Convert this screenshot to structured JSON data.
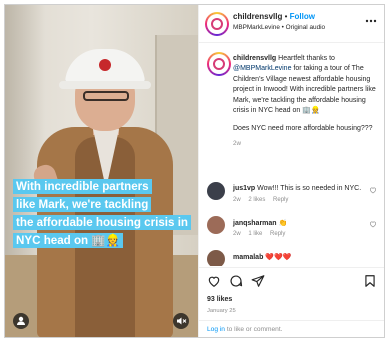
{
  "video": {
    "caption_lines": [
      "With incredible partners",
      "like Mark, we're tackling",
      "the affordable housing crisis in",
      "NYC head on 🏢👷"
    ],
    "user_tag_icon": "person-icon",
    "audio_icon": "speaker-muted-icon"
  },
  "header": {
    "username": "childrensvllg",
    "separator": "•",
    "follow_label": "Follow",
    "subline": "MBPMarkLevine • Original audio",
    "more_icon": "more-horizontal-icon"
  },
  "post": {
    "username": "childrensvllg",
    "text_before_mention": "Heartfelt thanks to",
    "mention": "@MBPMarkLevine",
    "text_after_mention": "for taking a tour of The Children's Village newest affordable housing project in Inwood! With incredible partners like Mark, we're tackling the affordable housing crisis in NYC head on 🏢👷",
    "question": "Does NYC need more affordable housing???",
    "time": "2w"
  },
  "comments": [
    {
      "username": "jus1vp",
      "text": "Wow!!! This is so needed in NYC.",
      "time": "2w",
      "likes": "2 likes",
      "reply": "Reply",
      "avatar_color": "#3b3f4a"
    },
    {
      "username": "janqsharman",
      "text": "👏",
      "time": "2w",
      "likes": "1 like",
      "reply": "Reply",
      "avatar_color": "#9c6b58"
    },
    {
      "username": "mamalab",
      "text": "❤️❤️❤️",
      "time": "",
      "likes": "",
      "reply": "",
      "avatar_color": "#7d5a48"
    }
  ],
  "actions": {
    "like_icon": "heart-icon",
    "comment_icon": "comment-icon",
    "share_icon": "send-icon",
    "save_icon": "bookmark-icon",
    "likes": "93 likes",
    "date": "January 25"
  },
  "login": {
    "link": "Log in",
    "text": "to like or comment."
  },
  "colors": {
    "caption_bg": "#5ac8ef",
    "follow_blue": "#0095f6",
    "text": "#262626",
    "muted": "#8e8e8e"
  }
}
